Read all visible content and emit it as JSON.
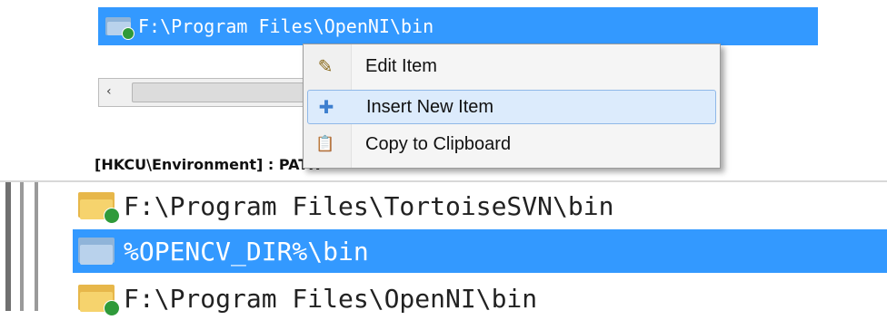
{
  "top_list": {
    "row_path": "F:\\Program Files\\OpenNI\\bin",
    "row_icon": "folder-check-icon",
    "scroll_left_arrow": "‹",
    "registry_label": "[HKCU\\Environment] : PATH"
  },
  "context_menu": {
    "items": [
      {
        "label": "Edit Item",
        "icon": "pencil-icon",
        "glyph": "✎"
      },
      {
        "label": "Insert New Item",
        "icon": "plus-icon",
        "glyph": "✚"
      },
      {
        "label": "Copy to Clipboard",
        "icon": "clipboard-icon",
        "glyph": "📋"
      }
    ],
    "highlighted_index": 1
  },
  "bottom_list": {
    "rows": [
      {
        "path": "F:\\Program Files\\TortoiseSVN\\bin",
        "icon": "folder-yellow-check-icon",
        "selected": false
      },
      {
        "path": "%OPENCV_DIR%\\bin",
        "icon": "folder-blue-icon",
        "selected": true
      },
      {
        "path": "F:\\Program Files\\OpenNI\\bin",
        "icon": "folder-yellow-check-icon",
        "selected": false
      }
    ]
  },
  "colors": {
    "selection": "#3399ff",
    "menu_highlight": "#dcebfc",
    "menu_highlight_border": "#8fb8e8"
  }
}
